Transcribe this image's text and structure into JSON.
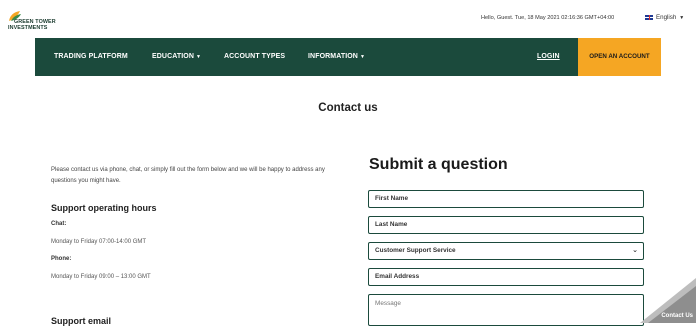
{
  "brand": {
    "name_line1": "GREEN TOWER",
    "name_line2": "INVESTMENTS",
    "logo_icon": "leaf-logo-icon",
    "colors": {
      "green": "#1b4a3c",
      "gold": "#f5a623"
    }
  },
  "topbar": {
    "greeting": "Hello, Guest. Tue, 18 May 2021 02:16:36 GMT+04:00",
    "language": "English"
  },
  "nav": {
    "items": [
      {
        "label": "TRADING PLATFORM",
        "dropdown": false
      },
      {
        "label": "EDUCATION",
        "dropdown": true
      },
      {
        "label": "ACCOUNT TYPES",
        "dropdown": false
      },
      {
        "label": "INFORMATION",
        "dropdown": true
      }
    ],
    "login": "LOGIN",
    "cta": "OPEN AN ACCOUNT"
  },
  "page": {
    "title": "Contact us"
  },
  "info": {
    "intro": "Please contact us via phone, chat, or simply fill out the form below and we will be happy to address any questions you might have.",
    "hours_title": "Support operating hours",
    "chat_label": "Chat:",
    "chat_hours": "Monday to Friday 07:00-14:00 GMT",
    "phone_label": "Phone:",
    "phone_hours": "Monday to Friday 09:00 – 13:00 GMT",
    "email_title": "Support email"
  },
  "form": {
    "title": "Submit a question",
    "first_name": "First Name",
    "last_name": "Last Name",
    "department": "Customer Support Service",
    "email": "Email Address",
    "message": "Message"
  },
  "contact_tab": {
    "label": "Contact Us"
  }
}
